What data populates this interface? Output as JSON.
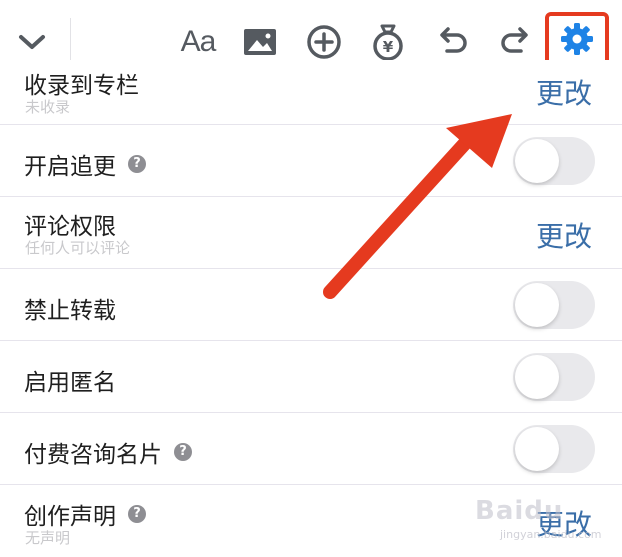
{
  "toolbar": {
    "icons": [
      {
        "name": "collapse-chevron-icon"
      },
      {
        "name": "font-format-icon",
        "text": "Aa"
      },
      {
        "name": "image-icon"
      },
      {
        "name": "insert-plus-icon"
      },
      {
        "name": "money-bag-icon"
      },
      {
        "name": "undo-icon"
      },
      {
        "name": "redo-icon"
      },
      {
        "name": "settings-gear-icon"
      }
    ],
    "icon_color": "#555a60",
    "settings_color": "#1e83e6",
    "highlight_color": "#e53a1f"
  },
  "settings": {
    "column": {
      "label": "收录到专栏",
      "sub": "未收录",
      "action": "更改"
    },
    "follow_updates": {
      "label": "开启追更",
      "on": false
    },
    "comment_permission": {
      "label": "评论权限",
      "sub": "任何人可以评论",
      "action": "更改"
    },
    "no_repost": {
      "label": "禁止转载",
      "on": false
    },
    "anonymous": {
      "label": "启用匿名",
      "on": false
    },
    "paid_consult_card": {
      "label": "付费咨询名片",
      "on": false
    },
    "creation_statement": {
      "label": "创作声明",
      "sub": "无声明",
      "action": "更改"
    }
  },
  "help_glyph": "?",
  "link_color": "#3a6ea8",
  "arrow_color": "#e53a1f",
  "watermark": {
    "text": "Baidu",
    "sub": "jingyan.baidu.com"
  }
}
